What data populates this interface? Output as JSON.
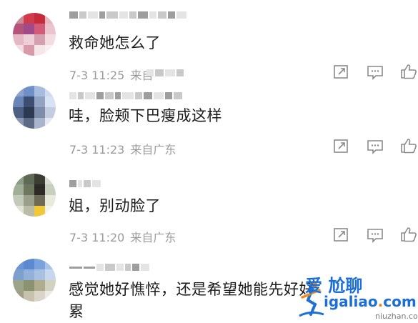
{
  "comments": [
    {
      "text": "救命她怎么了",
      "time": "7-3 11:25",
      "location": "来自"
    },
    {
      "text": "哇，脸颊下巴瘦成这样",
      "time": "7-3 11:23",
      "location": "来自广东"
    },
    {
      "text": "姐，别动脸了",
      "time": "7-3 11:20",
      "location": "来自广东"
    },
    {
      "text_line1": "感觉她好憔悴，还是希望她能先好好",
      "text_line2": "累"
    }
  ],
  "icons": {
    "share": "share-icon",
    "reply": "reply-icon",
    "like": "like-icon"
  },
  "watermark": {
    "top": "爱 尬聊",
    "brand_left": "igaliao",
    "brand_dot": ".",
    "brand_right": "com",
    "sub": "niuzhan.com"
  },
  "colors": {
    "text": "#1b1b1b",
    "meta": "#9a9a9a",
    "icon": "#8a8a8a",
    "watermark_blue": "#1d6fd8",
    "watermark_orange": "#f08a1e"
  }
}
